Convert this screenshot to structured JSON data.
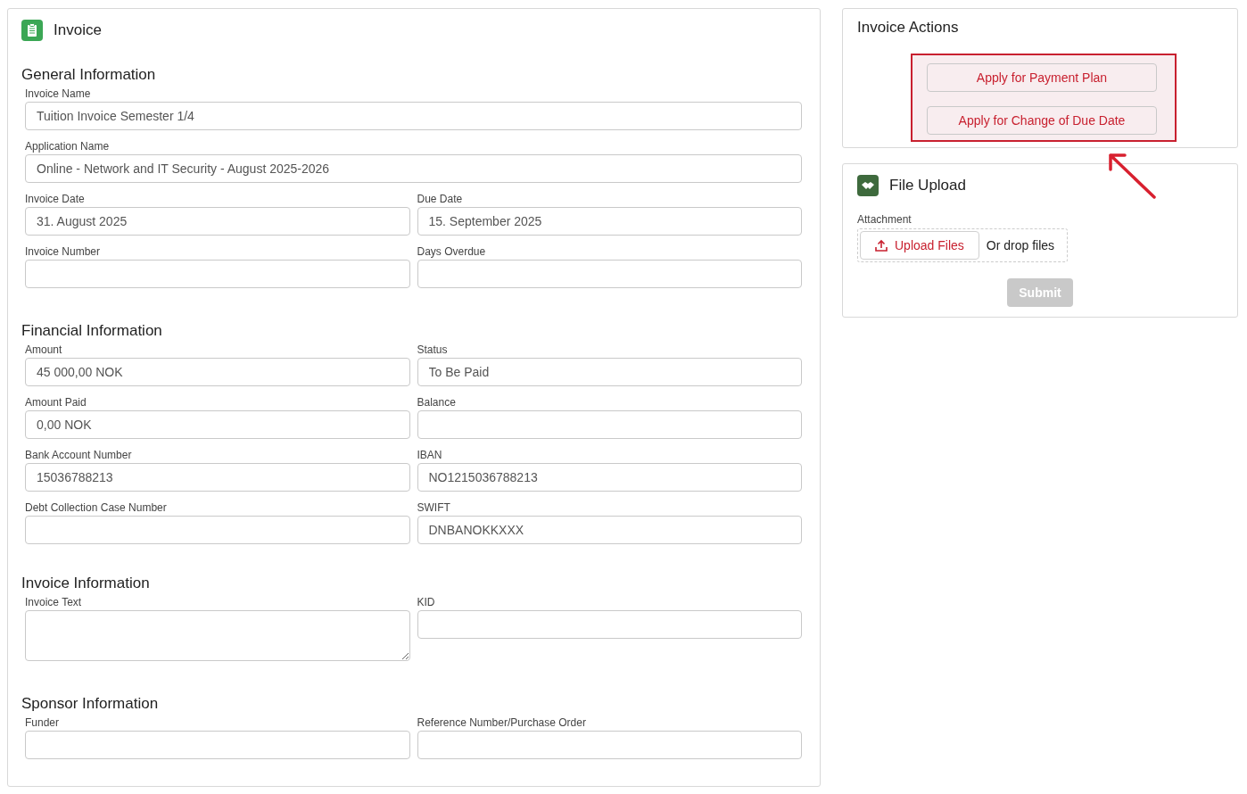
{
  "invoice": {
    "title": "Invoice",
    "sections": [
      {
        "heading": "General Information",
        "fields": [
          {
            "label": "Invoice Name",
            "value": "Tuition Invoice Semester 1/4",
            "kind": "text",
            "full_width": true
          },
          {
            "label": "Application Name",
            "value": "Online - Network and IT Security - August 2025-2026",
            "kind": "text",
            "full_width": true
          },
          {
            "label": "Invoice Date",
            "value": "31. August 2025",
            "kind": "text",
            "full_width": false
          },
          {
            "label": "Due Date",
            "value": "15. September 2025",
            "kind": "text",
            "full_width": false
          },
          {
            "label": "Invoice Number",
            "kind": "text",
            "full_width": false
          },
          {
            "label": "Days Overdue",
            "kind": "text",
            "full_width": false
          }
        ]
      },
      {
        "heading": "Financial Information",
        "fields": [
          {
            "label": "Amount",
            "value": "45 000,00 NOK",
            "kind": "text",
            "full_width": false
          },
          {
            "label": "Status",
            "value": "To Be Paid",
            "kind": "text",
            "full_width": false
          },
          {
            "label": "Amount Paid",
            "value": "0,00 NOK",
            "kind": "text",
            "full_width": false
          },
          {
            "label": "Balance",
            "kind": "text",
            "full_width": false
          },
          {
            "label": "Bank Account Number",
            "value": "15036788213",
            "kind": "text",
            "full_width": false
          },
          {
            "label": "IBAN",
            "value": "NO1215036788213",
            "kind": "text",
            "full_width": false
          },
          {
            "label": "Debt Collection Case Number",
            "kind": "text",
            "full_width": false
          },
          {
            "label": "SWIFT",
            "value": "DNBANOKKXXX",
            "kind": "text",
            "full_width": false
          }
        ]
      },
      {
        "heading": "Invoice Information",
        "fields": [
          {
            "label": "Invoice Text",
            "kind": "textarea",
            "full_width": false
          },
          {
            "label": "KID",
            "kind": "text",
            "full_width": false
          }
        ]
      },
      {
        "heading": "Sponsor Information",
        "fields": [
          {
            "label": "Funder",
            "kind": "text",
            "full_width": false
          },
          {
            "label": "Reference Number/Purchase Order",
            "kind": "text",
            "full_width": false
          }
        ]
      }
    ]
  },
  "invoice_actions": {
    "title": "Invoice Actions",
    "highlighted": true,
    "buttons": [
      "Apply for Payment Plan",
      "Apply for Change of Due Date"
    ]
  },
  "file_upload": {
    "title": "File Upload",
    "attachment_label": "Attachment",
    "upload_button": "Upload Files",
    "drop_hint": "Or drop files",
    "submit": {
      "label": "Submit",
      "disabled": true
    }
  }
}
